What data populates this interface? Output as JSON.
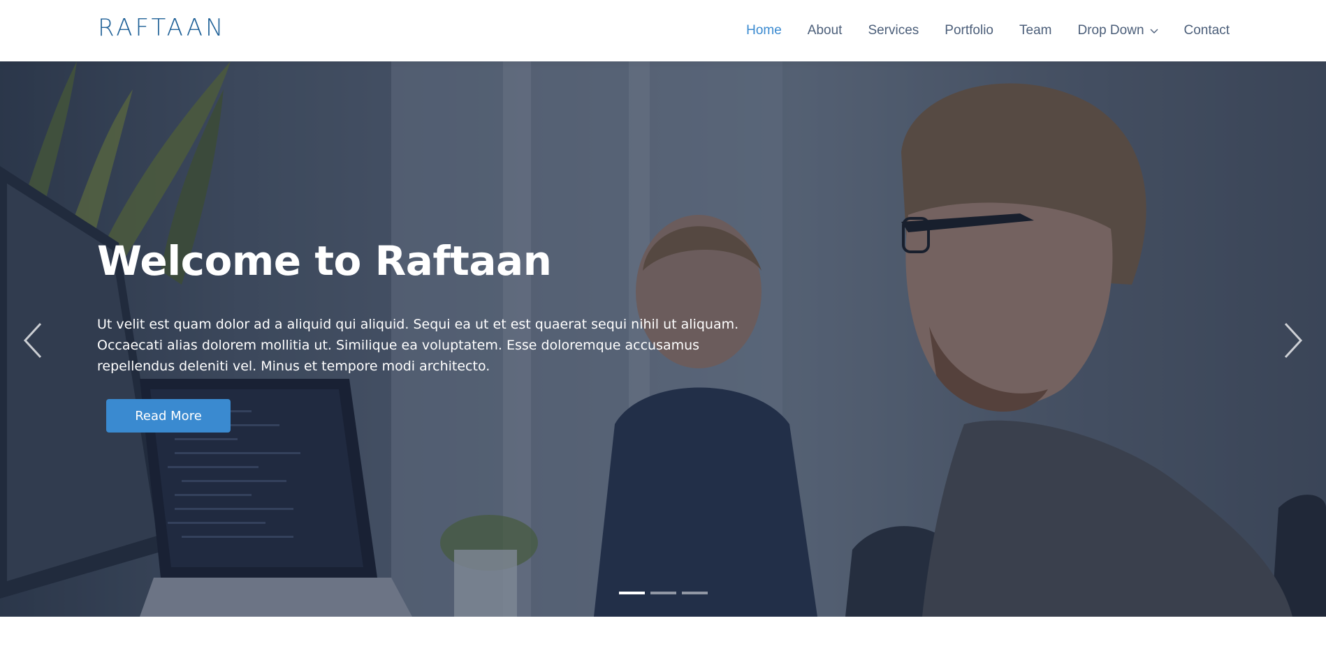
{
  "brand": {
    "logo_text": "RAFTAAN",
    "accent_color": "#3a8ad0",
    "logo_color": "#1d5f96"
  },
  "nav": {
    "items": [
      {
        "label": "Home",
        "active": true
      },
      {
        "label": "About"
      },
      {
        "label": "Services"
      },
      {
        "label": "Portfolio"
      },
      {
        "label": "Team"
      },
      {
        "label": "Drop Down",
        "icon": "chevron-down-icon"
      },
      {
        "label": "Contact"
      }
    ]
  },
  "hero": {
    "title": "Welcome to Raftaan",
    "text": "Ut velit est quam dolor ad a aliquid qui aliquid. Sequi ea ut et est quaerat sequi nihil ut aliquam. Occaecati alias dolorem mollitia ut. Similique ea voluptatem. Esse doloremque accusamus repellendus deleniti vel. Minus et tempore modi architecto.",
    "button_label": "Read More",
    "prev_icon": "chevron-left-icon",
    "next_icon": "chevron-right-icon",
    "slides_count": 3,
    "active_slide": 1
  }
}
